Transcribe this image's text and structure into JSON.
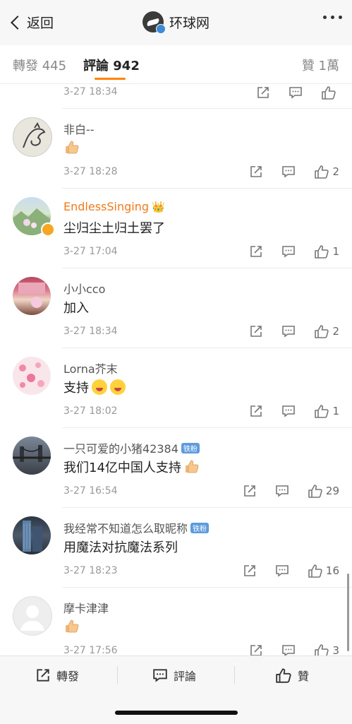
{
  "nav": {
    "back_label": "返回",
    "account_name": "环球网"
  },
  "tabs": {
    "repost": "轉發 445",
    "comment": "評論 942",
    "like": "贊 1萬"
  },
  "comments": [
    {
      "time": "3-27 18:34",
      "like_count": ""
    },
    {
      "user": "非白--",
      "text": "",
      "emoji": "thumbs-up",
      "time": "3-27 18:28",
      "like_count": "2"
    },
    {
      "user": "EndlessSinging",
      "user_emoji": "👑",
      "text": "尘归尘土归土罢了",
      "time": "3-27 17:04",
      "like_count": "1"
    },
    {
      "user": "小小cco",
      "text": "加入",
      "time": "3-27 18:34",
      "like_count": "2"
    },
    {
      "user": "Lorna芥末",
      "text": "支持",
      "emoji": "surprised-face-x2",
      "time": "3-27 18:02",
      "like_count": "1"
    },
    {
      "user": "一只可爱的小猪42384",
      "badge": "铁粉",
      "text": "我们14亿中国人支持",
      "emoji": "thumbs-up",
      "time": "3-27 16:54",
      "like_count": "29"
    },
    {
      "user": "我经常不知道怎么取昵称",
      "badge": "铁粉",
      "text": "用魔法对抗魔法系列",
      "time": "3-27 18:23",
      "like_count": "16"
    },
    {
      "user": "摩卡津津",
      "text": "",
      "emoji": "thumbs-up",
      "time": "3-27 17:56",
      "like_count": "3"
    }
  ],
  "bottom_bar": {
    "repost": "轉發",
    "comment": "評論",
    "like": "贊"
  },
  "colors": {
    "accent": "#ff8200",
    "vip_name": "#f27a1a",
    "badge": "#5d9bdc"
  }
}
